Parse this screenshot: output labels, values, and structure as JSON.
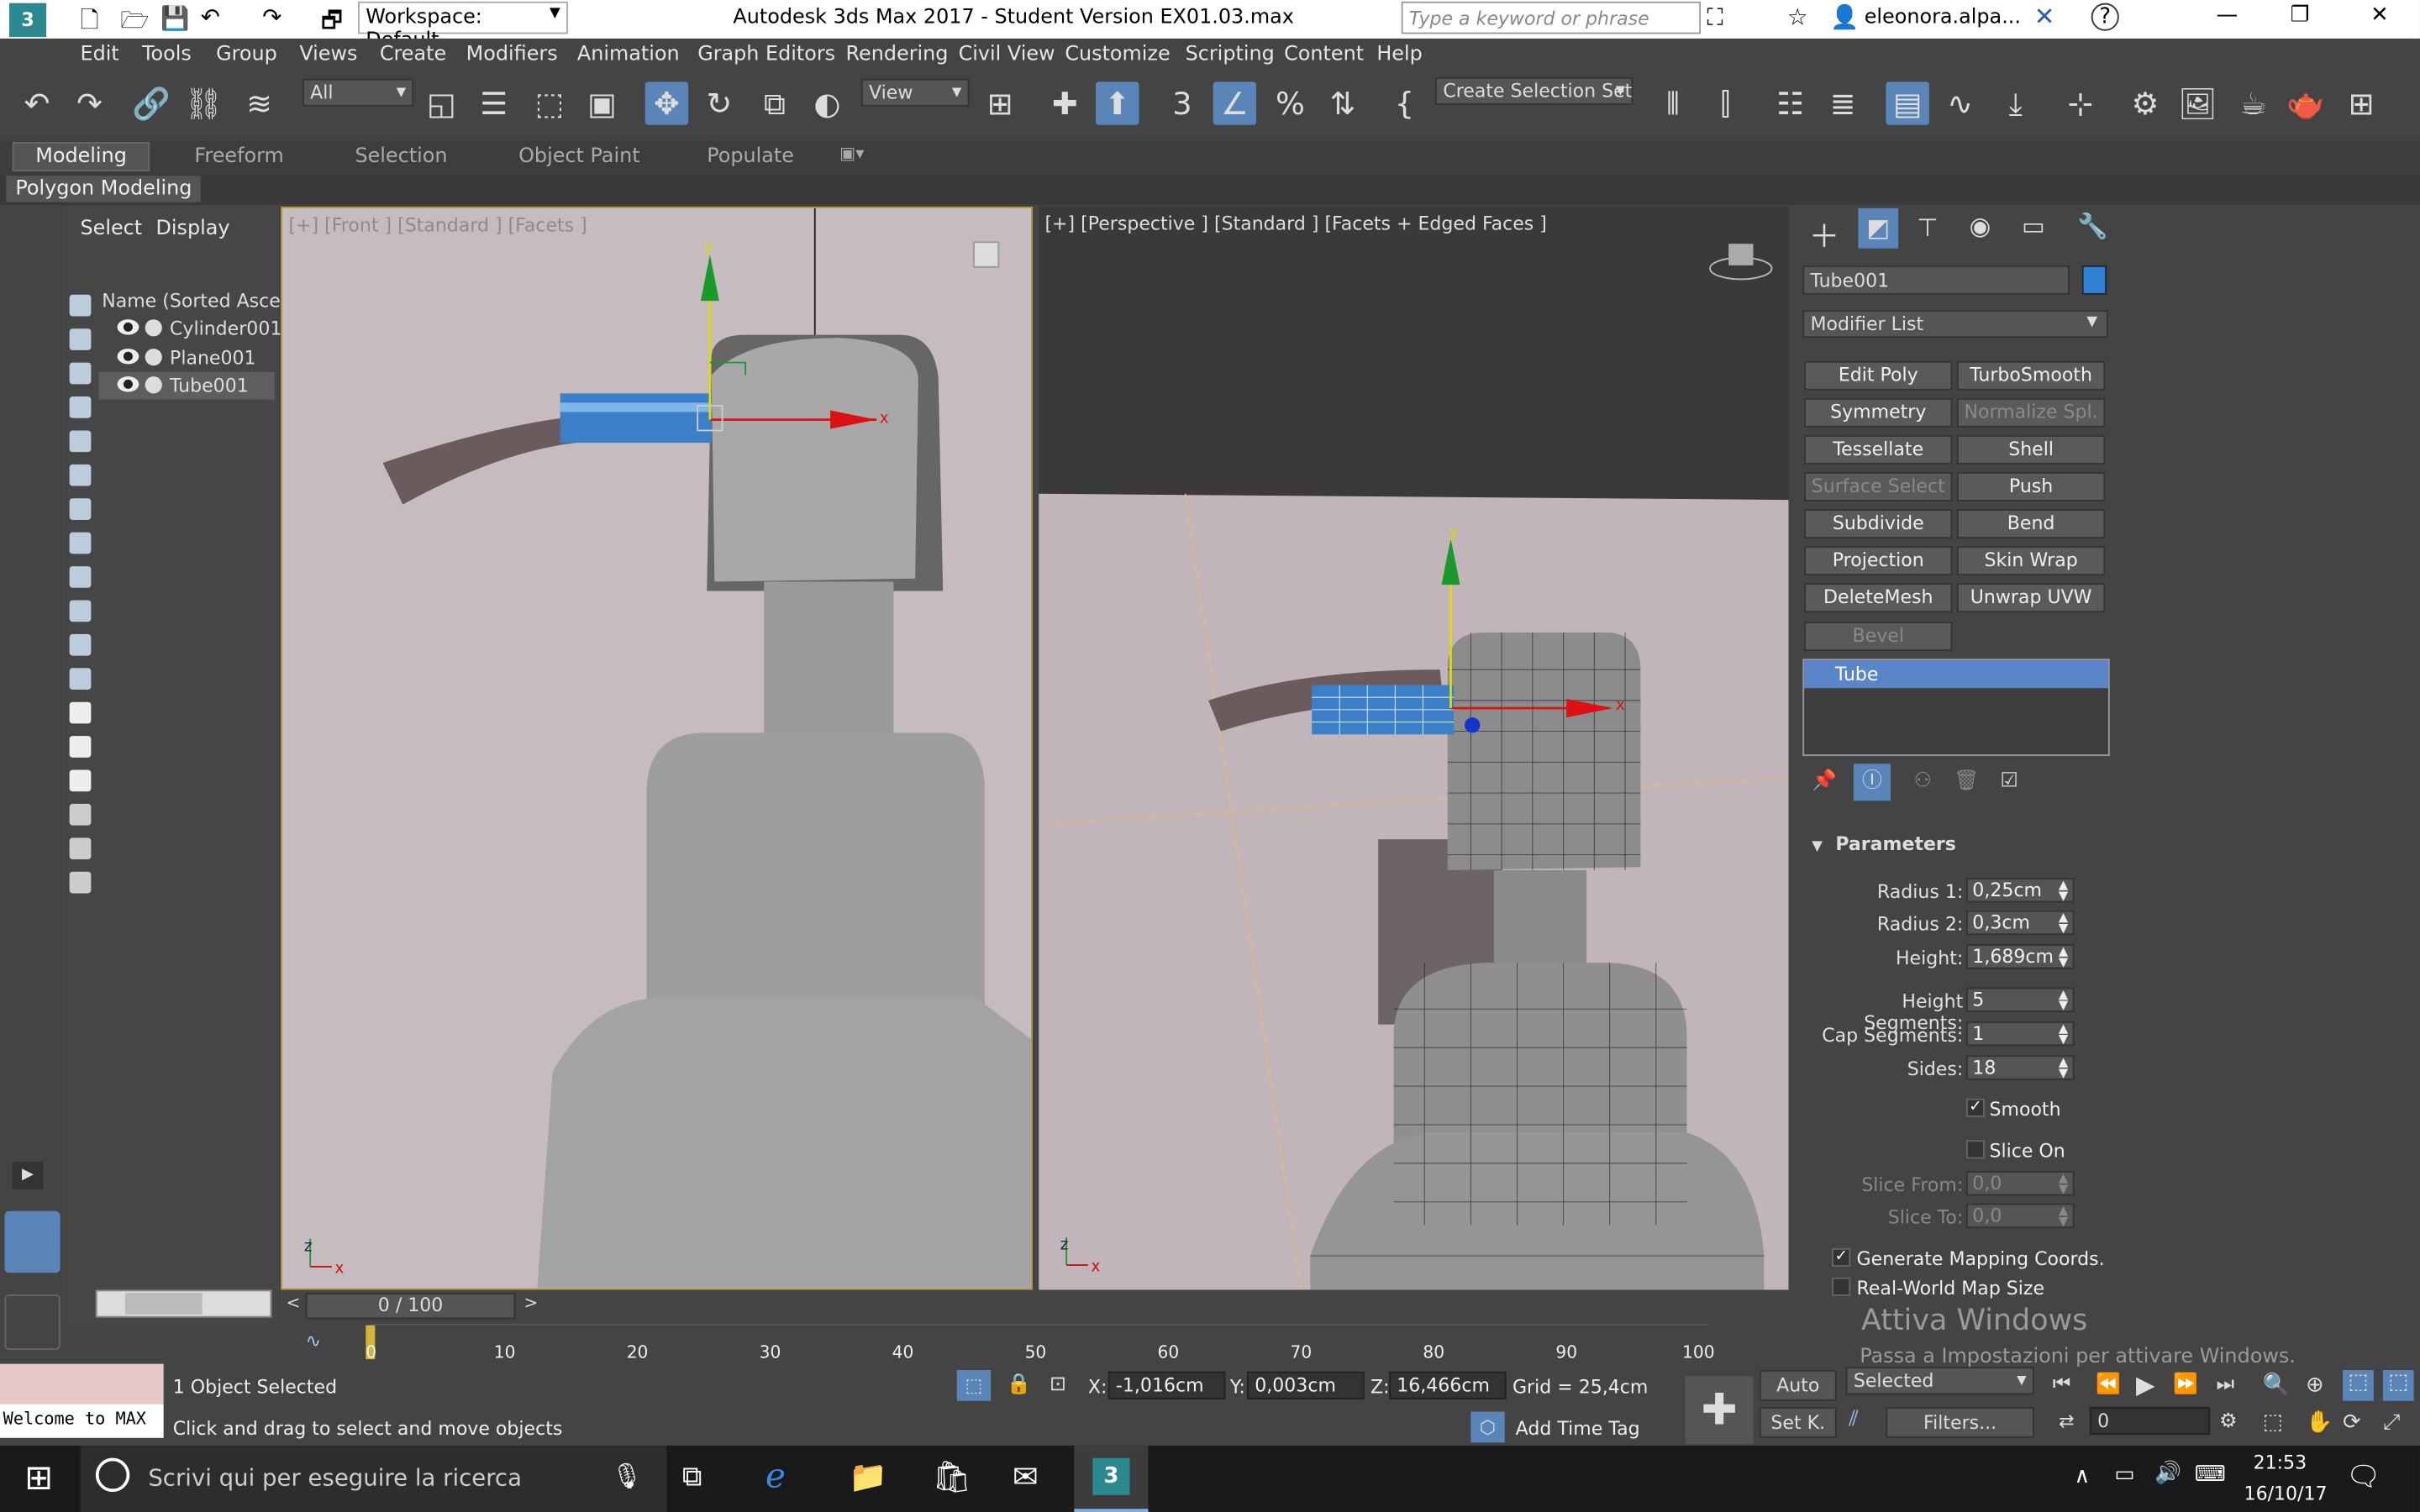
{
  "titlebar": {
    "workspace": "Workspace: Default",
    "title": "Autodesk 3ds Max 2017 - Student Version    EX01.03.max",
    "search_placeholder": "Type a keyword or phrase",
    "user": "eleonora.alpa...",
    "app_icon_label": "3"
  },
  "menu": [
    "Edit",
    "Tools",
    "Group",
    "Views",
    "Create",
    "Modifiers",
    "Animation",
    "Graph Editors",
    "Rendering",
    "Civil View",
    "Customize",
    "Scripting",
    "Content",
    "Help"
  ],
  "toolbar": {
    "filter": "All",
    "view": "View",
    "selection_set": "Create Selection Set"
  },
  "ribbon": {
    "tabs": [
      "Modeling",
      "Freeform",
      "Selection",
      "Object Paint",
      "Populate"
    ],
    "sub": "Polygon Modeling"
  },
  "scene": {
    "tab_select": "Select",
    "tab_display": "Display",
    "column": "Name (Sorted Ascend",
    "items": [
      "Cylinder001",
      "Plane001",
      "Tube001"
    ]
  },
  "viewports": {
    "left_label": "[+] [Front ] [Standard ] [Facets ]",
    "right_label": "[+] [Perspective ]  [Standard ]  [Facets + Edged Faces ]"
  },
  "cmd": {
    "object_name": "Tube001",
    "object_color": "#2f7fd4",
    "modifier_list": "Modifier List",
    "modifiers": [
      [
        "Edit Poly",
        "TurboSmooth"
      ],
      [
        "Symmetry",
        "Normalize Spl."
      ],
      [
        "Tessellate",
        "Shell"
      ],
      [
        "Surface Select",
        "Push"
      ],
      [
        "Subdivide",
        "Bend"
      ],
      [
        "Projection",
        "Skin Wrap"
      ],
      [
        "DeleteMesh",
        "Unwrap UVW"
      ],
      [
        "Bevel",
        ""
      ]
    ],
    "stack_item": "Tube",
    "rollout": "Parameters",
    "params": {
      "radius1_label": "Radius 1:",
      "radius1": "0,25cm",
      "radius2_label": "Radius 2:",
      "radius2": "0,3cm",
      "height_label": "Height:",
      "height": "1,689cm",
      "hseg_label": "Height Segments:",
      "hseg": "5",
      "cseg_label": "Cap Segments:",
      "cseg": "1",
      "sides_label": "Sides:",
      "sides": "18",
      "smooth": "Smooth",
      "slice_on": "Slice On",
      "slice_from_label": "Slice From:",
      "slice_from": "0,0",
      "slice_to_label": "Slice To:",
      "slice_to": "0,0",
      "gen_map": "Generate Mapping Coords.",
      "real_world": "Real-World Map Size"
    }
  },
  "timeline": {
    "frame": "0 / 100",
    "ticks": [
      "0",
      "10",
      "20",
      "30",
      "40",
      "50",
      "60",
      "70",
      "80",
      "90",
      "100"
    ]
  },
  "status": {
    "selected": "1 Object Selected",
    "hint": "Click and drag to select and move objects",
    "maxscript": "Welcome to MAX",
    "x_label": "X:",
    "x": "-1,016cm",
    "y_label": "Y:",
    "y": "0,003cm",
    "z_label": "Z:",
    "z": "16,466cm",
    "grid": "Grid = 25,4cm",
    "add_time_tag": "Add Time Tag",
    "auto": "Auto",
    "setk": "Set K.",
    "selected_dd": "Selected",
    "filters": "Filters...",
    "frame_field": "0",
    "watermark1": "Attiva Windows",
    "watermark2": "Passa a Impostazioni per attivare Windows."
  },
  "taskbar": {
    "search": "Scrivi qui per eseguire la ricerca",
    "time": "21:53",
    "date": "16/10/17"
  }
}
